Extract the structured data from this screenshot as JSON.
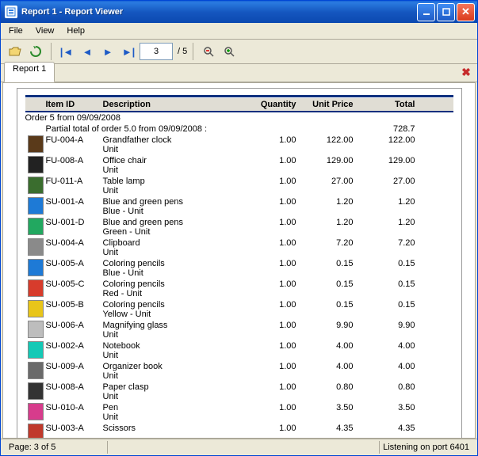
{
  "window": {
    "title": "Report 1 - Report Viewer"
  },
  "menu": {
    "file": "File",
    "view": "View",
    "help": "Help"
  },
  "toolbar": {
    "page_current": "3",
    "page_total": "/ 5"
  },
  "tabs": {
    "active": "Report 1"
  },
  "report": {
    "columns": {
      "item_id": "Item ID",
      "description": "Description",
      "quantity": "Quantity",
      "unit_price": "Unit Price",
      "total": "Total"
    },
    "order_line": "Order 5 from 09/09/2008",
    "partial_line": "Partial total of order 5.0 from 09/09/2008 :",
    "partial_total": "728.7",
    "rows": [
      {
        "icon": "#5a3a1a",
        "id": "FU-004-A",
        "desc1": "Grandfather clock",
        "desc2": "Unit",
        "qty": "1.00",
        "price": "122.00",
        "total": "122.00"
      },
      {
        "icon": "#222",
        "id": "FU-008-A",
        "desc1": "Office chair",
        "desc2": "Unit",
        "qty": "1.00",
        "price": "129.00",
        "total": "129.00"
      },
      {
        "icon": "#3a6d2e",
        "id": "FU-011-A",
        "desc1": "Table lamp",
        "desc2": "Unit",
        "qty": "1.00",
        "price": "27.00",
        "total": "27.00"
      },
      {
        "icon": "#1e7ad6",
        "id": "SU-001-A",
        "desc1": "Blue and green pens",
        "desc2": "Blue - Unit",
        "qty": "1.00",
        "price": "1.20",
        "total": "1.20"
      },
      {
        "icon": "#22a860",
        "id": "SU-001-D",
        "desc1": "Blue and green pens",
        "desc2": "Green - Unit",
        "qty": "1.00",
        "price": "1.20",
        "total": "1.20"
      },
      {
        "icon": "#8a8a8a",
        "id": "SU-004-A",
        "desc1": "Clipboard",
        "desc2": "Unit",
        "qty": "1.00",
        "price": "7.20",
        "total": "7.20"
      },
      {
        "icon": "#1e7ad6",
        "id": "SU-005-A",
        "desc1": "Coloring pencils",
        "desc2": "Blue - Unit",
        "qty": "1.00",
        "price": "0.15",
        "total": "0.15"
      },
      {
        "icon": "#d73c2c",
        "id": "SU-005-C",
        "desc1": "Coloring pencils",
        "desc2": "Red - Unit",
        "qty": "1.00",
        "price": "0.15",
        "total": "0.15"
      },
      {
        "icon": "#e8c51a",
        "id": "SU-005-B",
        "desc1": "Coloring pencils",
        "desc2": "Yellow - Unit",
        "qty": "1.00",
        "price": "0.15",
        "total": "0.15"
      },
      {
        "icon": "#bdbdbd",
        "id": "SU-006-A",
        "desc1": "Magnifying glass",
        "desc2": "Unit",
        "qty": "1.00",
        "price": "9.90",
        "total": "9.90"
      },
      {
        "icon": "#14c9b6",
        "id": "SU-002-A",
        "desc1": "Notebook",
        "desc2": "Unit",
        "qty": "1.00",
        "price": "4.00",
        "total": "4.00"
      },
      {
        "icon": "#6a6a6a",
        "id": "SU-009-A",
        "desc1": "Organizer book",
        "desc2": "Unit",
        "qty": "1.00",
        "price": "4.00",
        "total": "4.00"
      },
      {
        "icon": "#333",
        "id": "SU-008-A",
        "desc1": "Paper clasp",
        "desc2": "Unit",
        "qty": "1.00",
        "price": "0.80",
        "total": "0.80"
      },
      {
        "icon": "#d73c8c",
        "id": "SU-010-A",
        "desc1": "Pen",
        "desc2": "Unit",
        "qty": "1.00",
        "price": "3.50",
        "total": "3.50"
      },
      {
        "icon": "#c0392b",
        "id": "SU-003-A",
        "desc1": "Scissors",
        "desc2": "",
        "qty": "1.00",
        "price": "4.35",
        "total": "4.35"
      }
    ]
  },
  "status": {
    "page": "Page: 3 of 5",
    "right": "Listening on port 6401"
  }
}
